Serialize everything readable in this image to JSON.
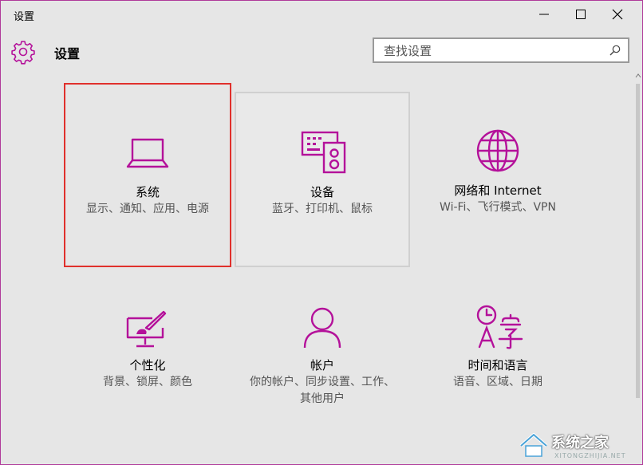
{
  "window": {
    "title": "设置"
  },
  "header": {
    "page_title": "设置"
  },
  "search": {
    "placeholder": "查找设置"
  },
  "tiles": [
    {
      "name": "系统",
      "desc": "显示、通知、应用、电源",
      "icon": "laptop-icon",
      "selected": true
    },
    {
      "name": "设备",
      "desc": "蓝牙、打印机、鼠标",
      "icon": "devices-icon"
    },
    {
      "name": "网络和 Internet",
      "desc": "Wi-Fi、飞行模式、VPN",
      "icon": "globe-icon"
    },
    {
      "name": "个性化",
      "desc": "背景、锁屏、颜色",
      "icon": "personalization-icon"
    },
    {
      "name": "帐户",
      "desc": "你的帐户、同步设置、工作、其他用户",
      "icon": "user-icon"
    },
    {
      "name": "时间和语言",
      "desc": "语音、区域、日期",
      "icon": "time-language-icon"
    }
  ],
  "watermark": {
    "text": "系统之家",
    "sub": "XITONGZHIJIA.NET"
  },
  "colors": {
    "accent": "#b4119a",
    "selection_border": "#e0302c"
  }
}
